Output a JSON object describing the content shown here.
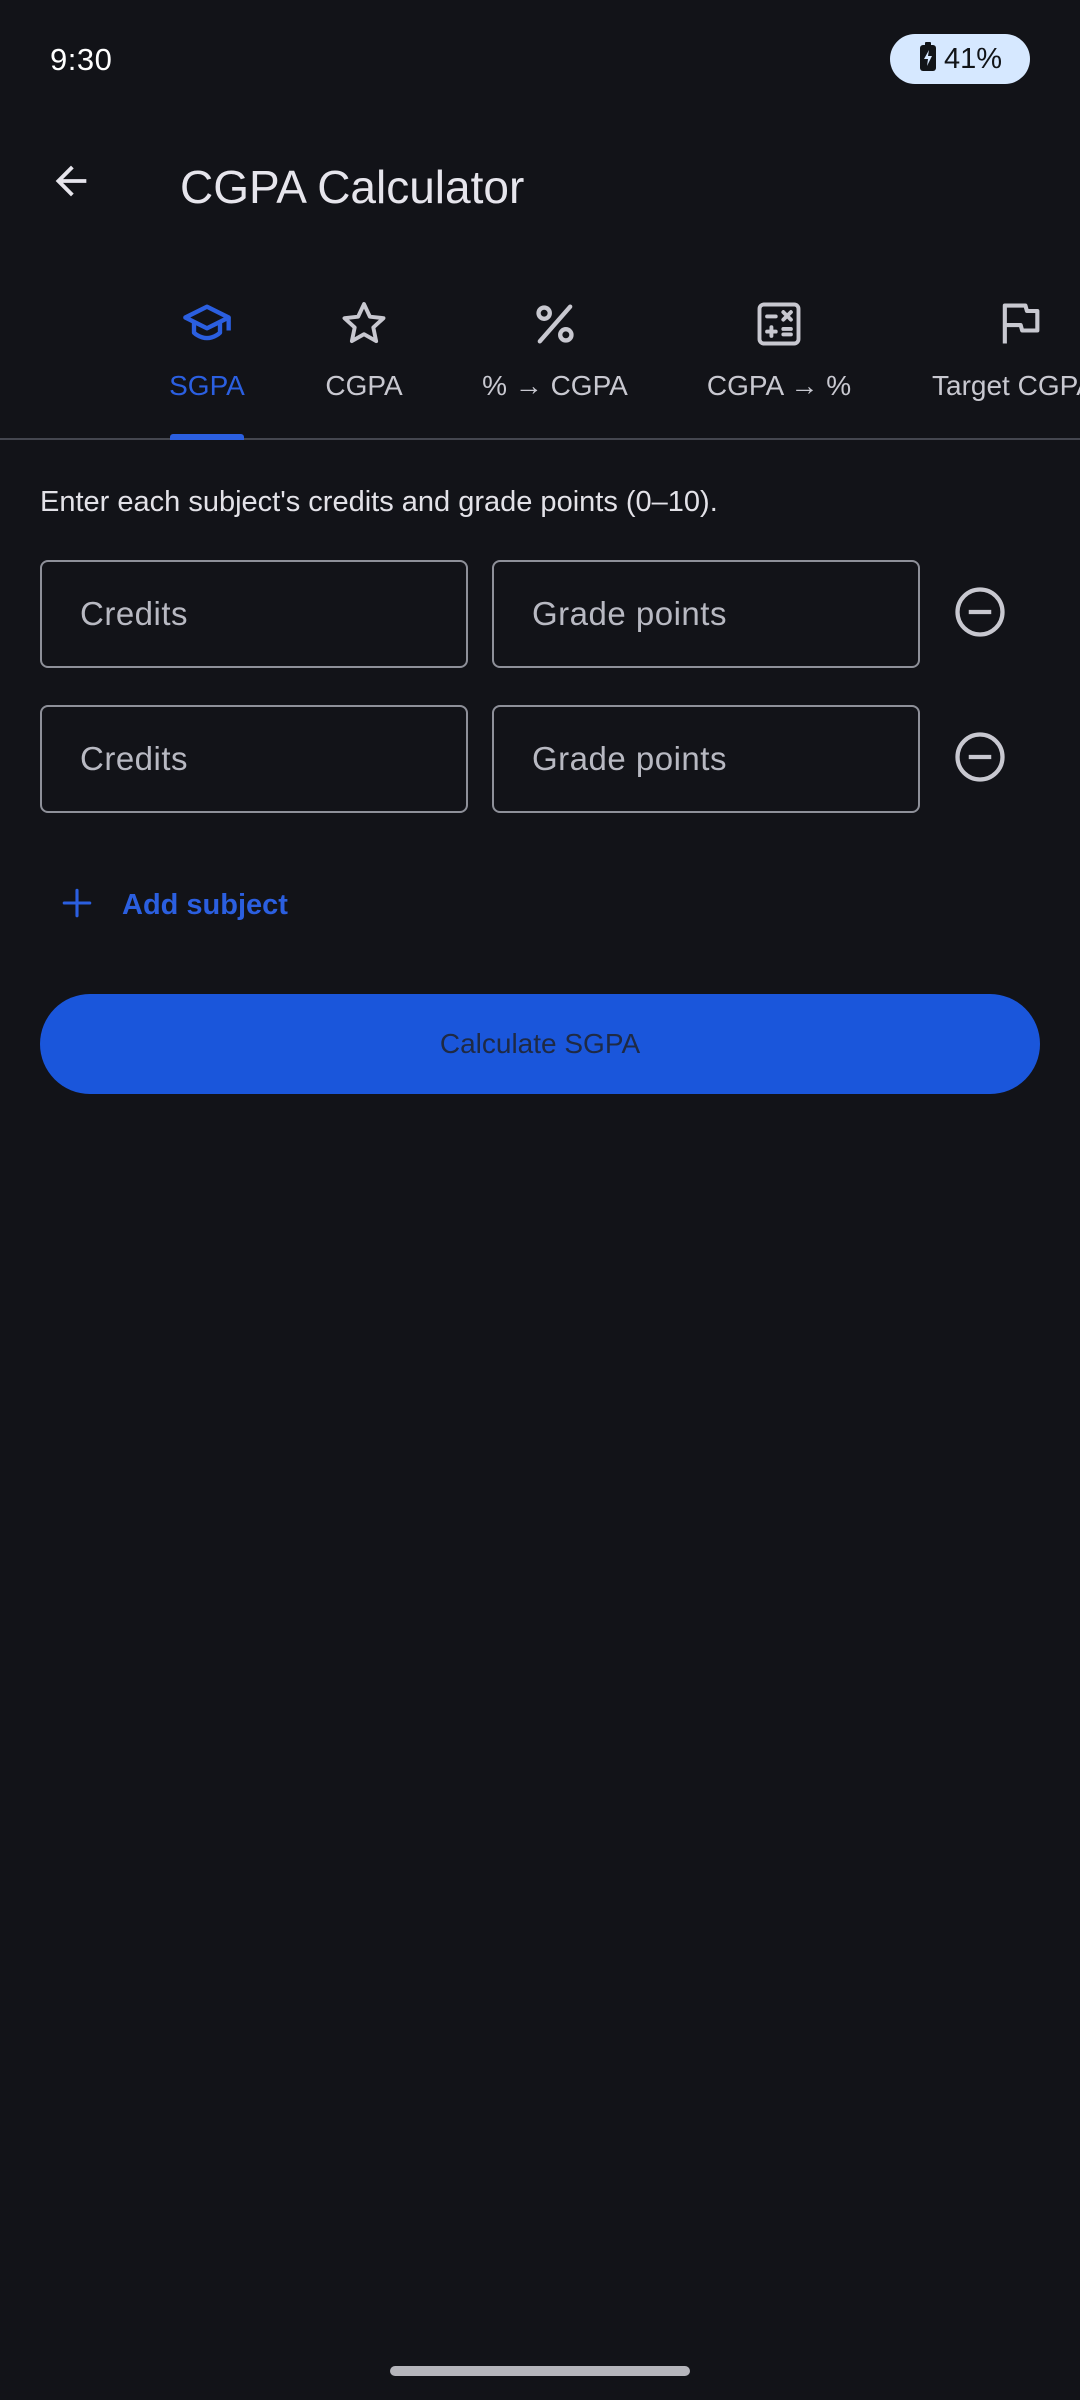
{
  "status_bar": {
    "time": "9:30",
    "battery": "41%"
  },
  "app_bar": {
    "title": "CGPA Calculator"
  },
  "tabs": [
    {
      "label": "SGPA",
      "icon": "graduation-cap-icon",
      "active": true
    },
    {
      "label": "CGPA",
      "icon": "star-icon",
      "active": false
    },
    {
      "label": "% → CGPA",
      "icon": "percent-icon",
      "active": false
    },
    {
      "label": "CGPA → %",
      "icon": "calculator-icon",
      "active": false
    },
    {
      "label": "Target CGPA",
      "icon": "flag-icon",
      "active": false
    }
  ],
  "content": {
    "instructions": "Enter each subject's credits and grade points (0–10).",
    "rows": [
      {
        "credits_placeholder": "Credits",
        "grade_placeholder": "Grade points",
        "credits_value": "",
        "grade_value": ""
      },
      {
        "credits_placeholder": "Credits",
        "grade_placeholder": "Grade points",
        "credits_value": "",
        "grade_value": ""
      }
    ],
    "add_subject_label": "Add subject",
    "calculate_label": "Calculate SGPA"
  },
  "colors": {
    "background": "#121318",
    "accent": "#2b5fe0",
    "button": "#1a56db",
    "battery_pill": "#d6e8ff"
  }
}
